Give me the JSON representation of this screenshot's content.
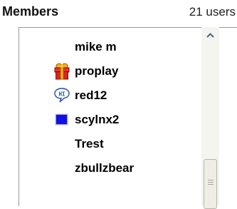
{
  "header": {
    "title": "Members",
    "count": "21 users"
  },
  "members": [
    {
      "name": "mike m",
      "icon": "none"
    },
    {
      "name": "proplay",
      "icon": "gift-icon"
    },
    {
      "name": "red12",
      "icon": "hi-speech-bubble-icon"
    },
    {
      "name": "scylnx2",
      "icon": "blue-square-icon"
    },
    {
      "name": "Trest",
      "icon": "none"
    },
    {
      "name": "zbullzbear",
      "icon": "none"
    }
  ],
  "colors": {
    "gift_red": "#d9261c",
    "gift_gold": "#f2b21b",
    "bubble_blue": "#1f4fb0",
    "square_blue": "#1010e8"
  }
}
